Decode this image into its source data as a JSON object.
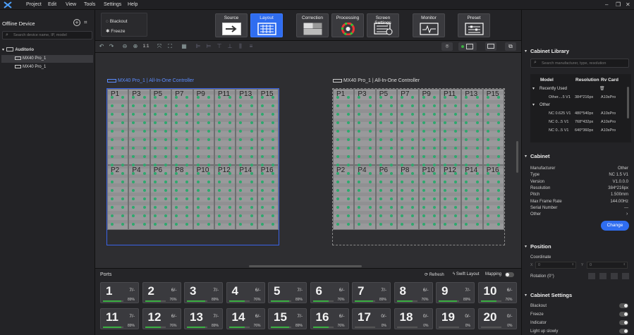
{
  "menu": {
    "items": [
      "Project",
      "Edit",
      "View",
      "Tools",
      "Settings",
      "Help"
    ],
    "window_controls": [
      "–",
      "❐",
      "✕"
    ]
  },
  "left": {
    "title": "Offline Device",
    "search_placeholder": "Search device name, IP, model",
    "tree": {
      "root": "Auditorio",
      "children": [
        "MX40 Pro_1",
        "MX40 Pro_1"
      ]
    }
  },
  "ribbon": {
    "blackout": "Blackout",
    "freeze": "Freeze",
    "buttons": [
      {
        "label": "Source",
        "icon": "source-icon"
      },
      {
        "label": "Layout",
        "icon": "layout-icon",
        "active": true
      },
      {
        "label": "Correction",
        "icon": "correction-icon"
      },
      {
        "label": "Processing",
        "icon": "processing-icon"
      },
      {
        "label": "Screen Settings",
        "icon": "screen-settings-icon"
      },
      {
        "label": "Monitor",
        "icon": "monitor-icon"
      },
      {
        "label": "Preset",
        "icon": "preset-icon"
      }
    ]
  },
  "toolbar": {
    "zoom_label": "1:1"
  },
  "canvas": {
    "screens": [
      {
        "title": "MX40 Pro_1 | All-In-One Controller",
        "selected": true
      },
      {
        "title": "MX40 Pro_1 | All-In-One Controller",
        "selected": false
      }
    ],
    "top_labels": [
      "P1",
      "P3",
      "P5",
      "P7",
      "P9",
      "P11",
      "P13",
      "P15"
    ],
    "bottom_labels": [
      "P2",
      "P4",
      "P6",
      "P8",
      "P10",
      "P12",
      "P14",
      "P16"
    ]
  },
  "ports": {
    "title": "Ports",
    "refresh": "Refresh",
    "swift": "Swift Layout",
    "mapping": "Mapping",
    "items": [
      {
        "n": "1",
        "c": "7/-",
        "p": "89%",
        "v": 0.89
      },
      {
        "n": "2",
        "c": "6/-",
        "p": "76%",
        "v": 0.76
      },
      {
        "n": "3",
        "c": "7/-",
        "p": "89%",
        "v": 0.89
      },
      {
        "n": "4",
        "c": "6/-",
        "p": "76%",
        "v": 0.76
      },
      {
        "n": "5",
        "c": "7/-",
        "p": "89%",
        "v": 0.89
      },
      {
        "n": "6",
        "c": "6/-",
        "p": "76%",
        "v": 0.76
      },
      {
        "n": "7",
        "c": "7/-",
        "p": "89%",
        "v": 0.89
      },
      {
        "n": "8",
        "c": "6/-",
        "p": "76%",
        "v": 0.76
      },
      {
        "n": "9",
        "c": "7/-",
        "p": "89%",
        "v": 0.89
      },
      {
        "n": "10",
        "c": "6/-",
        "p": "76%",
        "v": 0.76
      },
      {
        "n": "11",
        "c": "7/-",
        "p": "89%",
        "v": 0.89
      },
      {
        "n": "12",
        "c": "6/-",
        "p": "76%",
        "v": 0.76
      },
      {
        "n": "13",
        "c": "7/-",
        "p": "89%",
        "v": 0.89
      },
      {
        "n": "14",
        "c": "6/-",
        "p": "76%",
        "v": 0.76
      },
      {
        "n": "15",
        "c": "7/-",
        "p": "89%",
        "v": 0.89
      },
      {
        "n": "16",
        "c": "6/-",
        "p": "76%",
        "v": 0.76
      },
      {
        "n": "17",
        "c": "0/-",
        "p": "0%",
        "v": 0
      },
      {
        "n": "18",
        "c": "0/-",
        "p": "0%",
        "v": 0
      },
      {
        "n": "19",
        "c": "0/-",
        "p": "0%",
        "v": 0
      },
      {
        "n": "20",
        "c": "0/-",
        "p": "0%",
        "v": 0
      }
    ]
  },
  "library": {
    "title": "Cabinet Library",
    "search_placeholder": "Search manufacturer, type, resolution",
    "headers": [
      "Model",
      "Resolution",
      "Rv Card"
    ],
    "recently_used": "Recently Used",
    "other": "Other",
    "recent_rows": [
      {
        "model": "Other....5 V1",
        "res": "384*216px",
        "card": "A10sPro"
      }
    ],
    "other_rows": [
      {
        "model": "NC 0.625 V1",
        "res": "480*540px",
        "card": "A10sPro"
      },
      {
        "model": "NC 0...5 V1",
        "res": "768*432px",
        "card": "A10sPro"
      },
      {
        "model": "NC 0...5 V1",
        "res": "640*360px",
        "card": "A10sPro"
      }
    ]
  },
  "cabinet": {
    "title": "Cabinet",
    "rows": [
      {
        "k": "Manufacturer",
        "v": "Other"
      },
      {
        "k": "Type",
        "v": "NC 1.5 V1"
      },
      {
        "k": "Version",
        "v": "V1.0.0.0"
      },
      {
        "k": "Resolution",
        "v": "384*216px"
      },
      {
        "k": "Pitch",
        "v": "1.500mm"
      },
      {
        "k": "Max Frame Rate",
        "v": "144.00Hz"
      },
      {
        "k": "Serial Number",
        "v": "---"
      },
      {
        "k": "Other",
        "v": ""
      }
    ],
    "change": "Change"
  },
  "position": {
    "title": "Position",
    "coordinate": "Coordinate",
    "x_label": "X",
    "y_label": "Y",
    "x": "0",
    "y": "0",
    "rotation": "Rotation (0°)"
  },
  "cabinet_settings": {
    "title": "Cabinet Settings",
    "items": [
      "Blackout",
      "Freeze",
      "Indicator",
      "Light up slowly"
    ]
  },
  "colors": {
    "accent": "#2f6df0",
    "bg": "#1c1c1f",
    "green": "#3cb043"
  }
}
